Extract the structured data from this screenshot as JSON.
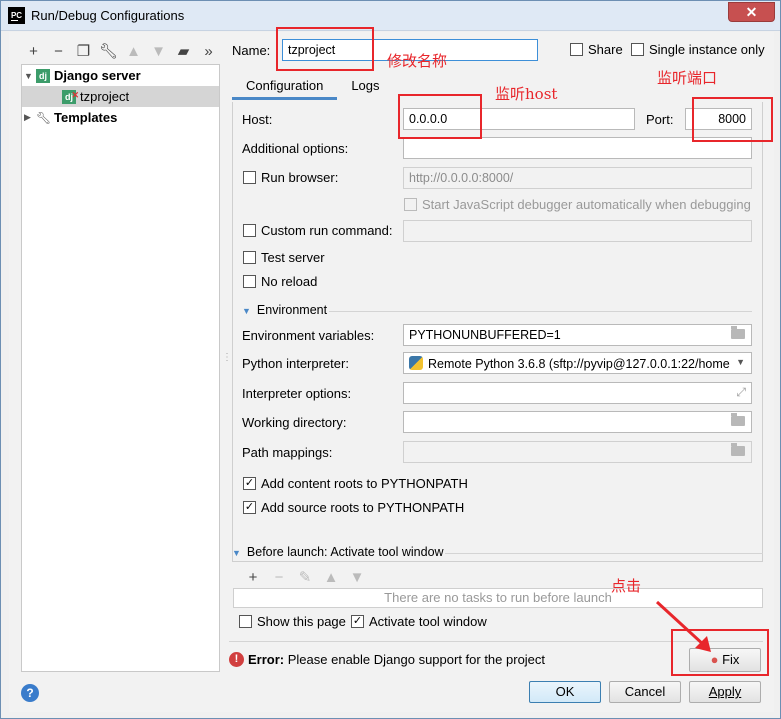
{
  "window": {
    "title": "Run/Debug Configurations",
    "close_label": "✕",
    "app_icon_label": "PC"
  },
  "left": {
    "tree": [
      {
        "label": "Django server",
        "expanded": true
      },
      {
        "label": "tzproject",
        "selected": true
      },
      {
        "label": "Templates",
        "expanded": false
      }
    ]
  },
  "header": {
    "name_label": "Name:",
    "name_value": "tzproject",
    "share_label": "Share",
    "single_instance_label": "Single instance only"
  },
  "tabs": [
    {
      "label": "Configuration",
      "active": true
    },
    {
      "label": "Logs"
    }
  ],
  "config": {
    "host_label": "Host:",
    "host_value": "0.0.0.0",
    "port_label": "Port:",
    "port_value": "8000",
    "additional_options_label": "Additional options:",
    "run_browser_label": "Run browser:",
    "run_browser_url": "http://0.0.0.0:8000/",
    "js_debugger_label": "Start JavaScript debugger automatically when debugging",
    "custom_run_label": "Custom run command:",
    "test_server_label": "Test server",
    "no_reload_label": "No reload",
    "environment_label": "Environment",
    "env_vars_label": "Environment variables:",
    "env_vars_value": "PYTHONUNBUFFERED=1",
    "python_interp_label": "Python interpreter:",
    "python_interp_value": "Remote Python 3.6.8 (sftp://pyvip@127.0.0.1:22/home",
    "interp_options_label": "Interpreter options:",
    "working_dir_label": "Working directory:",
    "path_mappings_label": "Path mappings:",
    "content_roots_label": "Add content roots to PYTHONPATH",
    "source_roots_label": "Add source roots to PYTHONPATH"
  },
  "before_launch": {
    "title": "Before launch: Activate tool window",
    "empty_text": "There are no tasks to run before launch",
    "show_page_label": "Show this page",
    "activate_tool_label": "Activate tool window"
  },
  "error": {
    "prefix": "Error:",
    "message": "Please enable Django support for the project",
    "fix_label": "Fix"
  },
  "footer": {
    "ok_label": "OK",
    "cancel_label": "Cancel",
    "apply_label": "Apply",
    "help_label": "?"
  },
  "annotations": {
    "rename": "修改名称",
    "listen_host": "监听host",
    "listen_port": "监听端口",
    "click": "点击"
  },
  "colors": {
    "annotation_red": "#e8262b",
    "tab_accent": "#4a88c7",
    "django_green": "#3c9c6a"
  }
}
